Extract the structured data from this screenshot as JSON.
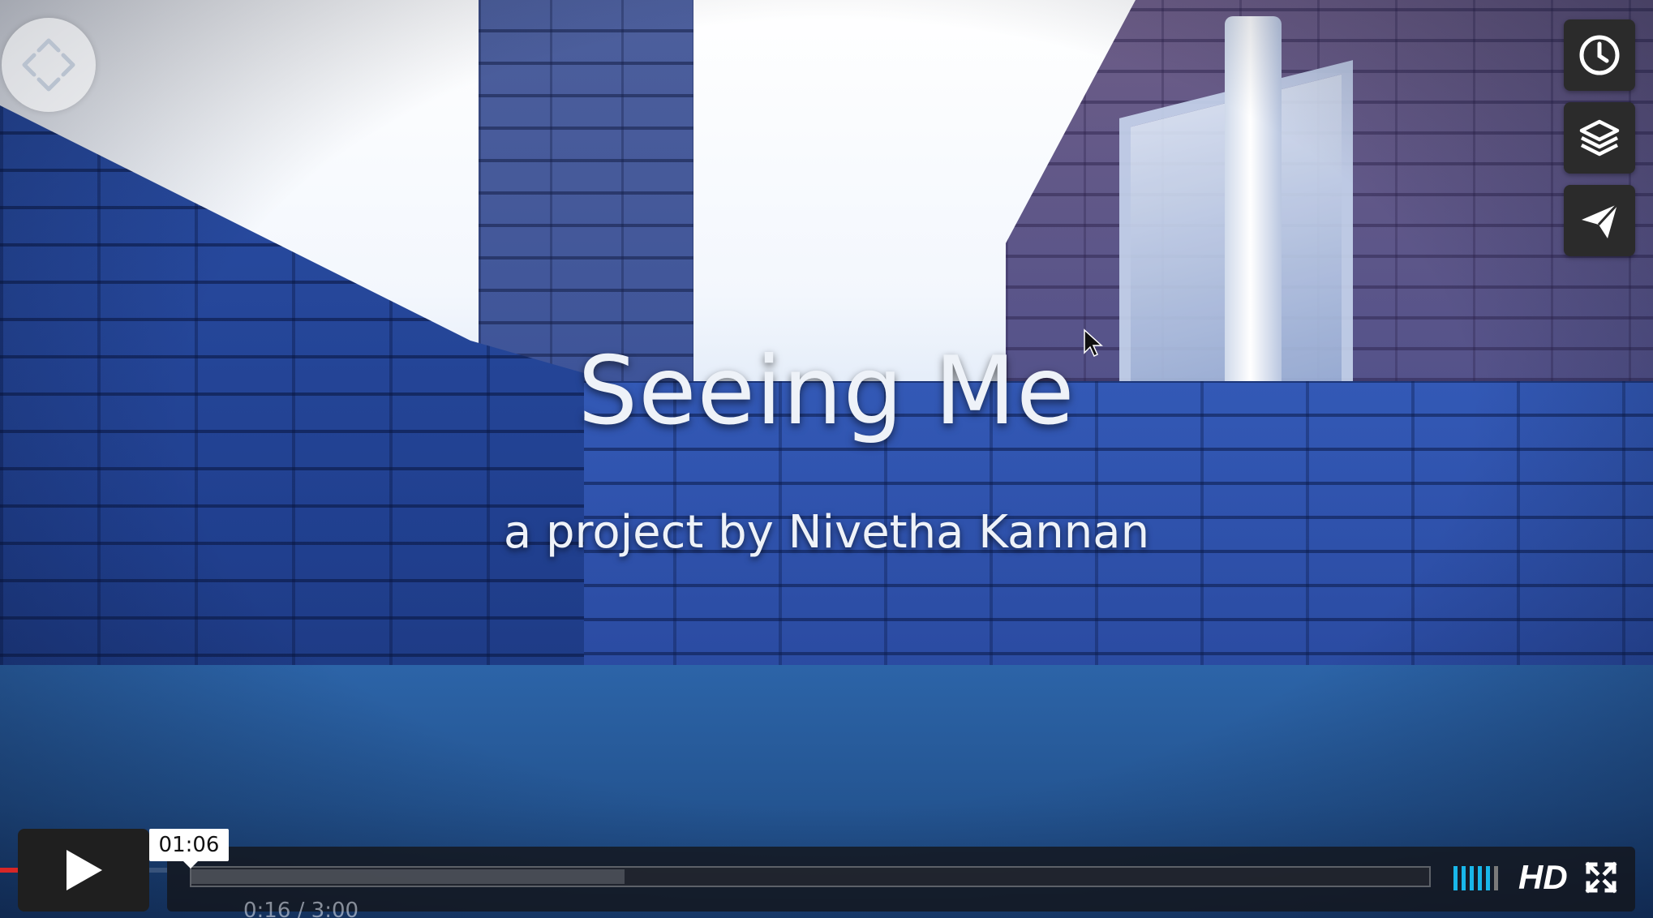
{
  "video": {
    "title": "Seeing Me",
    "subtitle": "a project by Nivetha Kannan"
  },
  "nav360": {
    "icon": "360-navigation-icon"
  },
  "side_buttons": [
    {
      "icon": "clock-icon",
      "action": "watch-later"
    },
    {
      "icon": "layers-icon",
      "action": "collections"
    },
    {
      "icon": "send-icon",
      "action": "share"
    }
  ],
  "controls": {
    "play_icon": "play-icon",
    "hover_time": "01:06",
    "current_time": "0:16",
    "duration": "3:00",
    "time_readout": "0:16 / 3:00",
    "progress_fraction": 0.09,
    "loaded_fraction": 0.35,
    "volume_level": 0.8,
    "hd_label": "HD",
    "fullscreen_icon": "fullscreen-icon",
    "accent_color": "#19b7ea",
    "progress_color": "#d72727"
  }
}
